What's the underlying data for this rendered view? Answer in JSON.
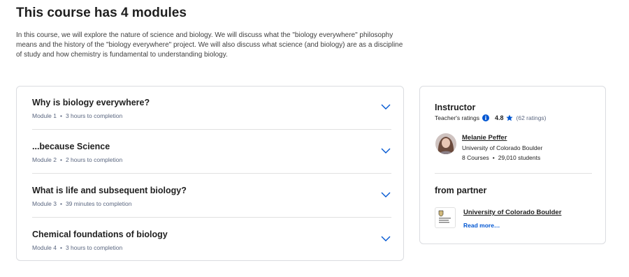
{
  "heading": "This course has 4 modules",
  "description": "In this course, we will explore the nature of science and biology. We will discuss what the \"biology everywhere\" philosophy means and the history of the \"biology everywhere\" project. We will also discuss what science (and biology) are as a discipline of study and how chemistry is fundamental to understanding biology.",
  "modules": [
    {
      "title": "Why is biology everywhere?",
      "module": "Module 1",
      "duration": "3 hours to completion"
    },
    {
      "title": "...because Science",
      "module": "Module 2",
      "duration": "2 hours to completion"
    },
    {
      "title": "What is life and subsequent biology?",
      "module": "Module 3",
      "duration": "39 minutes to completion"
    },
    {
      "title": "Chemical foundations of biology",
      "module": "Module 4",
      "duration": "3 hours to completion"
    }
  ],
  "separator": "•",
  "instructor": {
    "section_title": "Instructor",
    "ratings_label": "Teacher's ratings",
    "rating": "4.8",
    "ratings_count": "(62 ratings)",
    "name": "Melanie Peffer",
    "organization": "University of Colorado Boulder",
    "courses": "8 Courses",
    "students": "29,010 students"
  },
  "partner": {
    "section_title": "from partner",
    "name": "University of Colorado Boulder",
    "read_more": "Read more…",
    "logo_text": "University of Colorado Boulder"
  },
  "colors": {
    "link_blue": "#0056d2",
    "chevron_blue": "#0056d2",
    "meta_gray": "#5b6780"
  }
}
